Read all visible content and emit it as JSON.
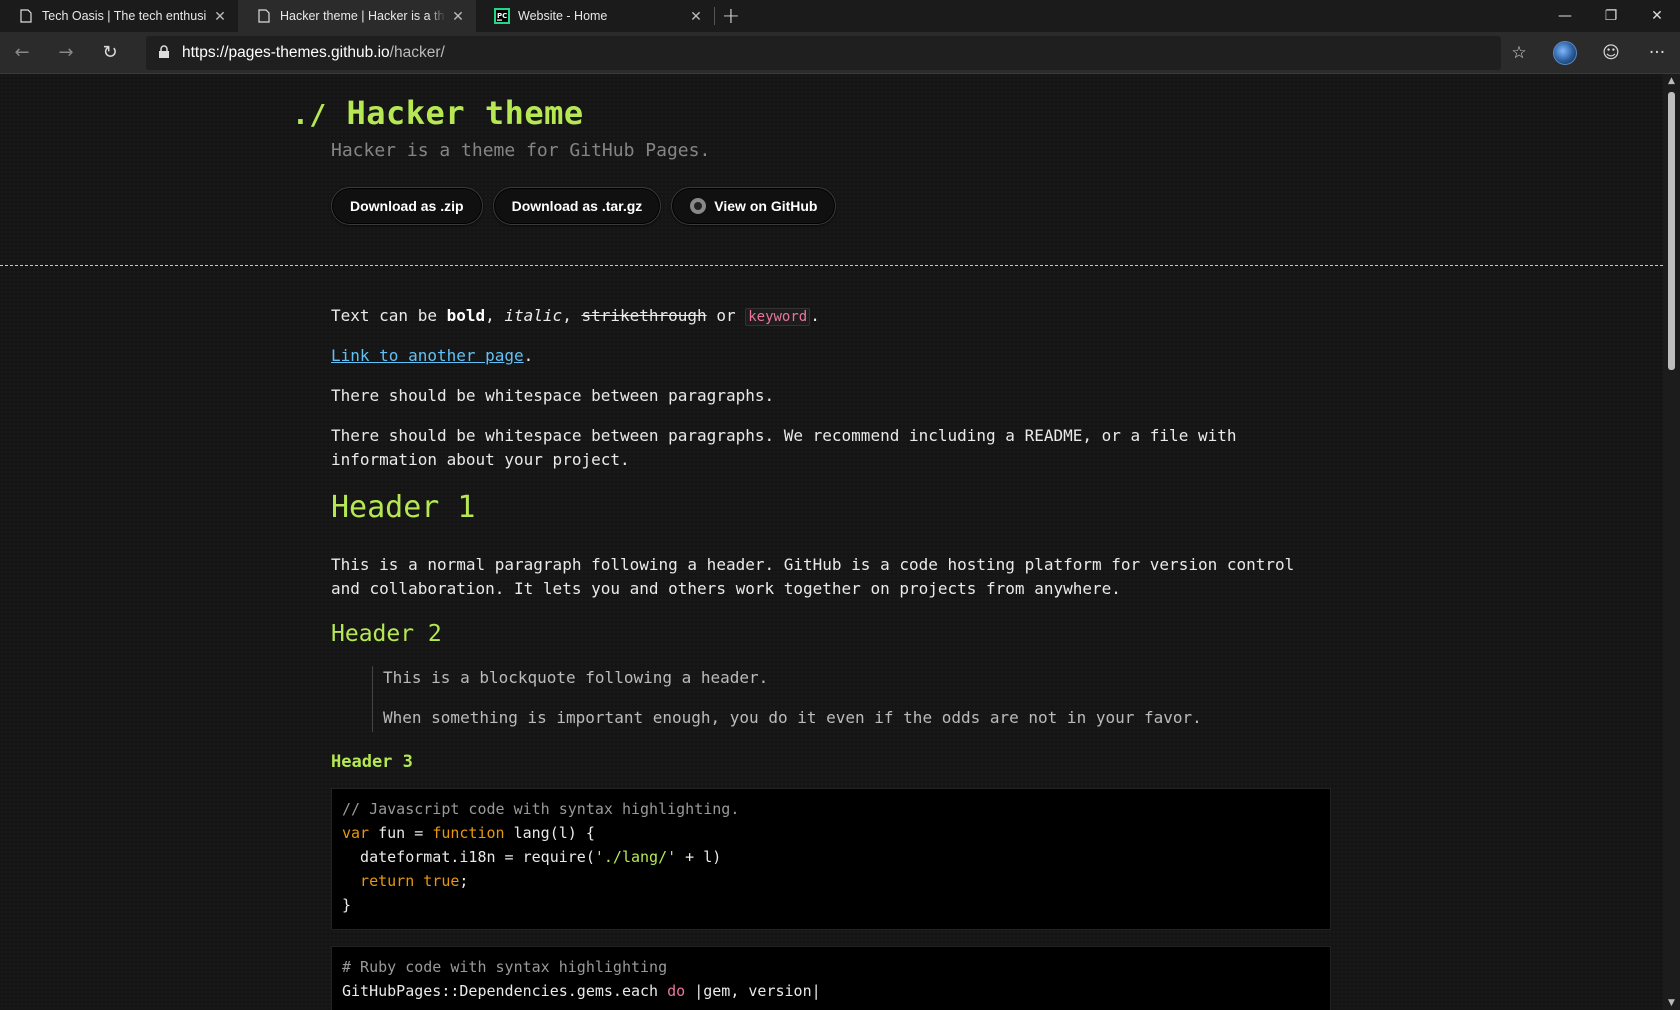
{
  "browser": {
    "tabs": [
      {
        "title": "Tech Oasis | The tech enthusiasts",
        "icon": "page-icon",
        "active": false
      },
      {
        "title": "Hacker theme | Hacker is a theme",
        "icon": "page-icon",
        "active": true
      },
      {
        "title": "Website - Home",
        "icon": "pycharm-icon",
        "active": false
      }
    ],
    "close_glyph": "✕",
    "new_tab_glyph": "+",
    "window_controls": {
      "minimize": "—",
      "restore": "❐",
      "close": "✕"
    },
    "nav": {
      "back": "←",
      "forward": "→",
      "refresh": "↻"
    },
    "address": {
      "host": "https://pages-themes.github.io",
      "path": "/hacker/"
    },
    "tools": {
      "favorite": "☆",
      "feedback": "☺",
      "more": "···"
    }
  },
  "page": {
    "title_prefix": "./",
    "title": "Hacker theme",
    "tagline": "Hacker is a theme for GitHub Pages.",
    "buttons": {
      "zip": "Download as .zip",
      "tar": "Download as .tar.gz",
      "github": "View on GitHub"
    },
    "paragraphs": {
      "p1_start": "Text can be ",
      "p1_bold": "bold",
      "p1_sep1": ", ",
      "p1_italic": "italic",
      "p1_sep2": ", ",
      "p1_strike": "strikethrough",
      "p1_or": " or ",
      "p1_keyword": "keyword",
      "p1_end": ".",
      "link": "Link to another page",
      "link_end": ".",
      "p3": "There should be whitespace between paragraphs.",
      "p4_line1": "There should be whitespace between paragraphs. We recommend including a README, or a file with",
      "p4_line2": "information about your project.",
      "h1": "Header 1",
      "p5_line1": "This is a normal paragraph following a header. GitHub is a code hosting platform for version control",
      "p5_line2": "and collaboration. It lets you and others work together on projects from anywhere.",
      "h2": "Header 2",
      "bq1": "This is a blockquote following a header.",
      "bq2": "When something is important enough, you do it even if the odds are not in your favor.",
      "h3": "Header 3"
    },
    "code1": {
      "comment": "// Javascript code with syntax highlighting.",
      "l2_var": "var",
      "l2_mid": " fun = ",
      "l2_fn": "function",
      "l2_end": " lang(l) {",
      "l3_start": "  dateformat.i18n = require(",
      "l3_str": "'./lang/'",
      "l3_end": " + l)",
      "l4_ret": "  return",
      "l4_true": " true",
      "l4_end": ";",
      "l5": "}"
    },
    "code2": {
      "comment": "# Ruby code with syntax highlighting",
      "l2_start": "GitHubPages::Dependencies.gems.each ",
      "l2_do": "do",
      "l2_end": " |gem, version|"
    }
  },
  "colors": {
    "accent": "#b5e853",
    "link": "#63c0f5",
    "keyword": "#e8769e",
    "background": "#151515"
  }
}
